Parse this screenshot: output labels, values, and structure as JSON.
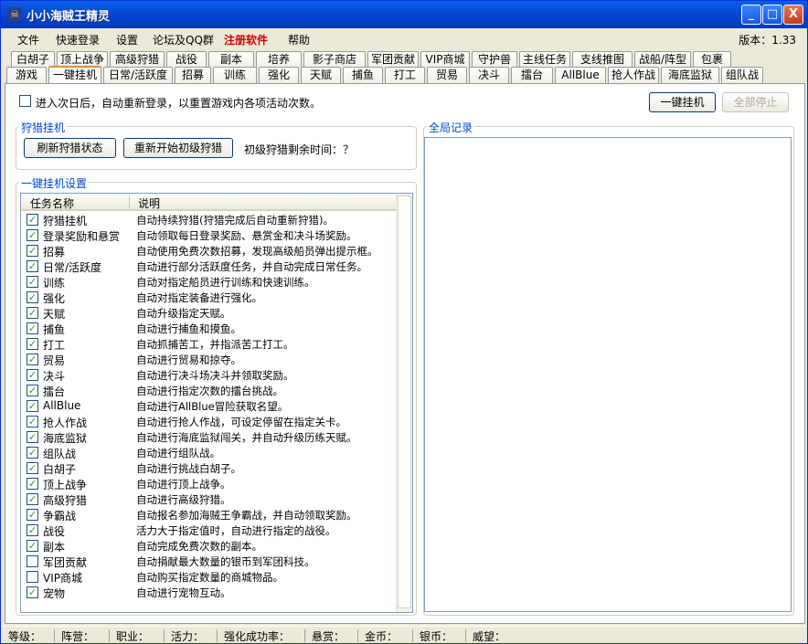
{
  "window": {
    "title": "小小海贼王精灵",
    "minimize": "_",
    "maximize": "□",
    "close": "X"
  },
  "menu": {
    "items": [
      "文件",
      "快速登录",
      "设置",
      "论坛及QQ群"
    ],
    "register": "注册软件",
    "help": "帮助",
    "version": "版本：1.33"
  },
  "tabs_row1": [
    "白胡子",
    "顶上战争",
    "高级狩猎",
    "战役",
    "副本",
    "培养",
    "影子商店",
    "军团贡献",
    "VIP商城",
    "守护兽",
    "主线任务",
    "支线推图",
    "战船/阵型",
    "包裹"
  ],
  "tabs_row2": [
    "游戏",
    "一键挂机",
    "日常/活跃度",
    "招募",
    "训练",
    "强化",
    "天赋",
    "捕鱼",
    "打工",
    "贸易",
    "决斗",
    "擂台",
    "AllBlue",
    "抢人作战",
    "海底监狱",
    "组队战"
  ],
  "active_tab": "一键挂机",
  "relogin": {
    "label": "进入次日后，自动重新登录，以重置游戏内各项活动次数。",
    "checked": false
  },
  "buttons": {
    "one_key": "一键挂机",
    "stop_all": "全部停止"
  },
  "hunt": {
    "group_label": "狩猎挂机",
    "refresh": "刷新狩猎状态",
    "restart": "重新开始初级狩猎",
    "remaining": "初级狩猎剩余时间：？"
  },
  "global": {
    "group_label": "全局记录"
  },
  "settings": {
    "group_label": "一键挂机设置",
    "col_name": "任务名称",
    "col_desc": "说明"
  },
  "tasks": [
    {
      "name": "狩猎挂机",
      "desc": "自动持续狩猎(狩猎完成后自动重新狩猎)。",
      "checked": true
    },
    {
      "name": "登录奖励和悬赏",
      "desc": "自动领取每日登录奖励、悬赏金和决斗场奖励。",
      "checked": true
    },
    {
      "name": "招募",
      "desc": "自动使用免费次数招募，发现高级船员弹出提示框。",
      "checked": true
    },
    {
      "name": "日常/活跃度",
      "desc": "自动进行部分活跃度任务，并自动完成日常任务。",
      "checked": true
    },
    {
      "name": "训练",
      "desc": "自动对指定船员进行训练和快速训练。",
      "checked": true
    },
    {
      "name": "强化",
      "desc": "自动对指定装备进行强化。",
      "checked": true
    },
    {
      "name": "天赋",
      "desc": "自动升级指定天赋。",
      "checked": true
    },
    {
      "name": "捕鱼",
      "desc": "自动进行捕鱼和摸鱼。",
      "checked": true
    },
    {
      "name": "打工",
      "desc": "自动抓捕苦工，并指派苦工打工。",
      "checked": true
    },
    {
      "name": "贸易",
      "desc": "自动进行贸易和掠夺。",
      "checked": true
    },
    {
      "name": "决斗",
      "desc": "自动进行决斗场决斗并领取奖励。",
      "checked": true
    },
    {
      "name": "擂台",
      "desc": "自动进行指定次数的擂台挑战。",
      "checked": true
    },
    {
      "name": "AllBlue",
      "desc": "自动进行AllBlue冒险获取名望。",
      "checked": true
    },
    {
      "name": "抢人作战",
      "desc": "自动进行抢人作战，可设定停留在指定关卡。",
      "checked": true
    },
    {
      "name": "海底监狱",
      "desc": "自动进行海底监狱闯关，并自动升级历练天赋。",
      "checked": true
    },
    {
      "name": "组队战",
      "desc": "自动进行组队战。",
      "checked": true
    },
    {
      "name": "白胡子",
      "desc": "自动进行挑战白胡子。",
      "checked": true
    },
    {
      "name": "顶上战争",
      "desc": "自动进行顶上战争。",
      "checked": true
    },
    {
      "name": "高级狩猎",
      "desc": "自动进行高级狩猎。",
      "checked": true
    },
    {
      "name": "争霸战",
      "desc": "自动报名参加海贼王争霸战，并自动领取奖励。",
      "checked": true
    },
    {
      "name": "战役",
      "desc": "活力大于指定值时，自动进行指定的战役。",
      "checked": true
    },
    {
      "name": "副本",
      "desc": "自动完成免费次数的副本。",
      "checked": true
    },
    {
      "name": "军团贡献",
      "desc": "自动捐献最大数量的银币到军团科技。",
      "checked": false
    },
    {
      "name": "VIP商城",
      "desc": "自动购买指定数量的商城物品。",
      "checked": false
    },
    {
      "name": "宠物",
      "desc": "自动进行宠物互动。",
      "checked": true
    }
  ],
  "status": [
    "等级：",
    "阵营：",
    "职业：",
    "活力：",
    "强化成功率：",
    "悬赏：",
    "金币：",
    "银币：",
    "威望："
  ]
}
